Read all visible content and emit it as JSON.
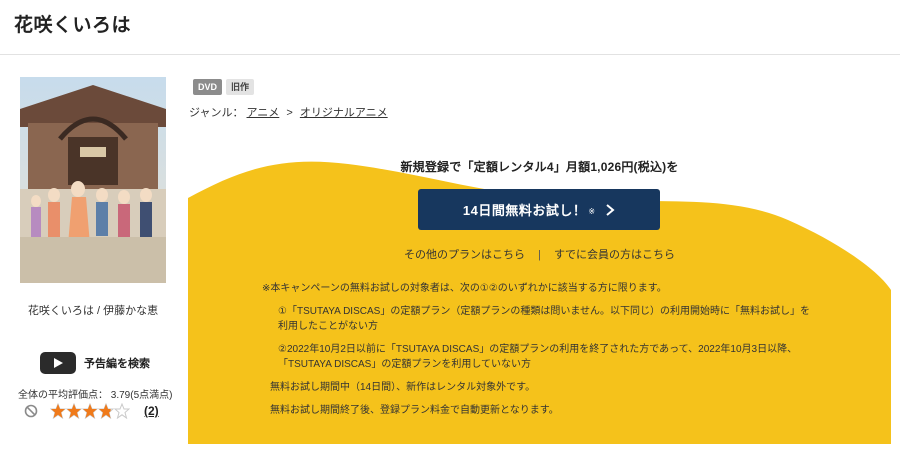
{
  "page": {
    "title": "花咲くいろは"
  },
  "product": {
    "caption": "花咲くいろは / 伊藤かな恵",
    "trailer_label": "予告編を検索",
    "rating_text": "全体の平均評価点： 3.79(5点満点)",
    "rating_value": 3.79,
    "rating_max": 5,
    "review_count": "(2)"
  },
  "badges": {
    "dvd": "DVD",
    "old": "旧作"
  },
  "genre": {
    "label": "ジャンル：",
    "links": [
      "アニメ",
      "オリジナルアニメ"
    ],
    "separator": ">"
  },
  "promo": {
    "headline": "新規登録で「定額レンタル4」月額1,026円(税込)を",
    "button_label": "14日間無料お試し！",
    "button_mark": "※",
    "link_other_plans": "その他のプランはこちら",
    "link_divider": "|",
    "link_members": "すでに会員の方はこちら",
    "notes": {
      "main": "※本キャンペーンの無料お試しの対象者は、次の①②のいずれかに該当する方に限ります。",
      "item1_line1": "①「TSUTAYA DISCAS」の定額プラン（定額プランの種類は問いません。以下同じ）の利用開始時に「無料お試し」を",
      "item1_line2": "利用したことがない方",
      "item2_line1": "②2022年10月2日以前に「TSUTAYA DISCAS」の定額プランの利用を終了された方であって、2022年10月3日以降、",
      "item2_line2": "「TSUTAYA DISCAS」の定額プランを利用していない方",
      "trial_period": "無料お試し期間中（14日間）、新作はレンタル対象外です。",
      "after_trial": "無料お試し期間終了後、登録プラン料金で自動更新となります。"
    }
  },
  "colors": {
    "accent_yellow": "#f5c21b",
    "button_navy": "#17375e",
    "star_orange": "#f07a1a"
  },
  "icons": {
    "play": "play-icon",
    "chevron": "chevron-right-icon",
    "ban": "ban-icon",
    "star": "star-icon"
  }
}
